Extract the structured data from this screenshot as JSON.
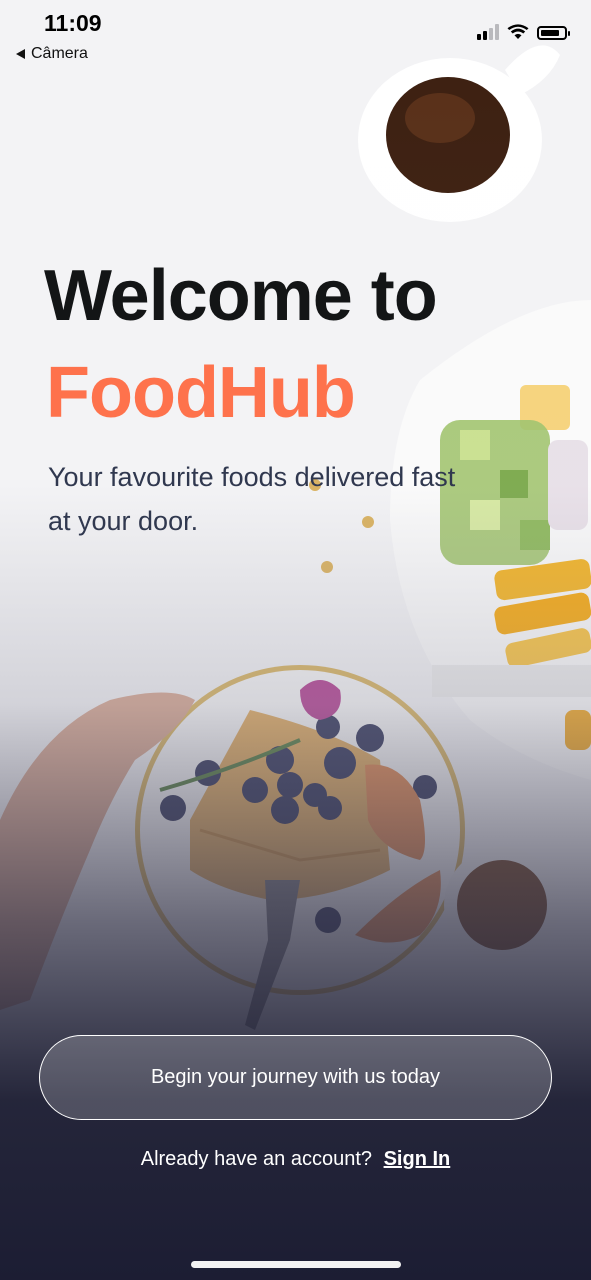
{
  "status_bar": {
    "time": "11:09",
    "back_label": "Câmera"
  },
  "hero": {
    "title_line1": "Welcome to",
    "title_line2": "FoodHub",
    "subtitle": "Your favourite foods delivered fast at your door."
  },
  "actions": {
    "primary_label": "Begin your journey with us today",
    "signin_prompt": "Already have an account?",
    "signin_link": "Sign In"
  },
  "colors": {
    "brand": "#fe724c",
    "dark_bg": "#1c1d33",
    "title": "#131516"
  },
  "icons": [
    "back-arrow-icon",
    "cellular-signal-icon",
    "wifi-icon",
    "battery-icon"
  ]
}
